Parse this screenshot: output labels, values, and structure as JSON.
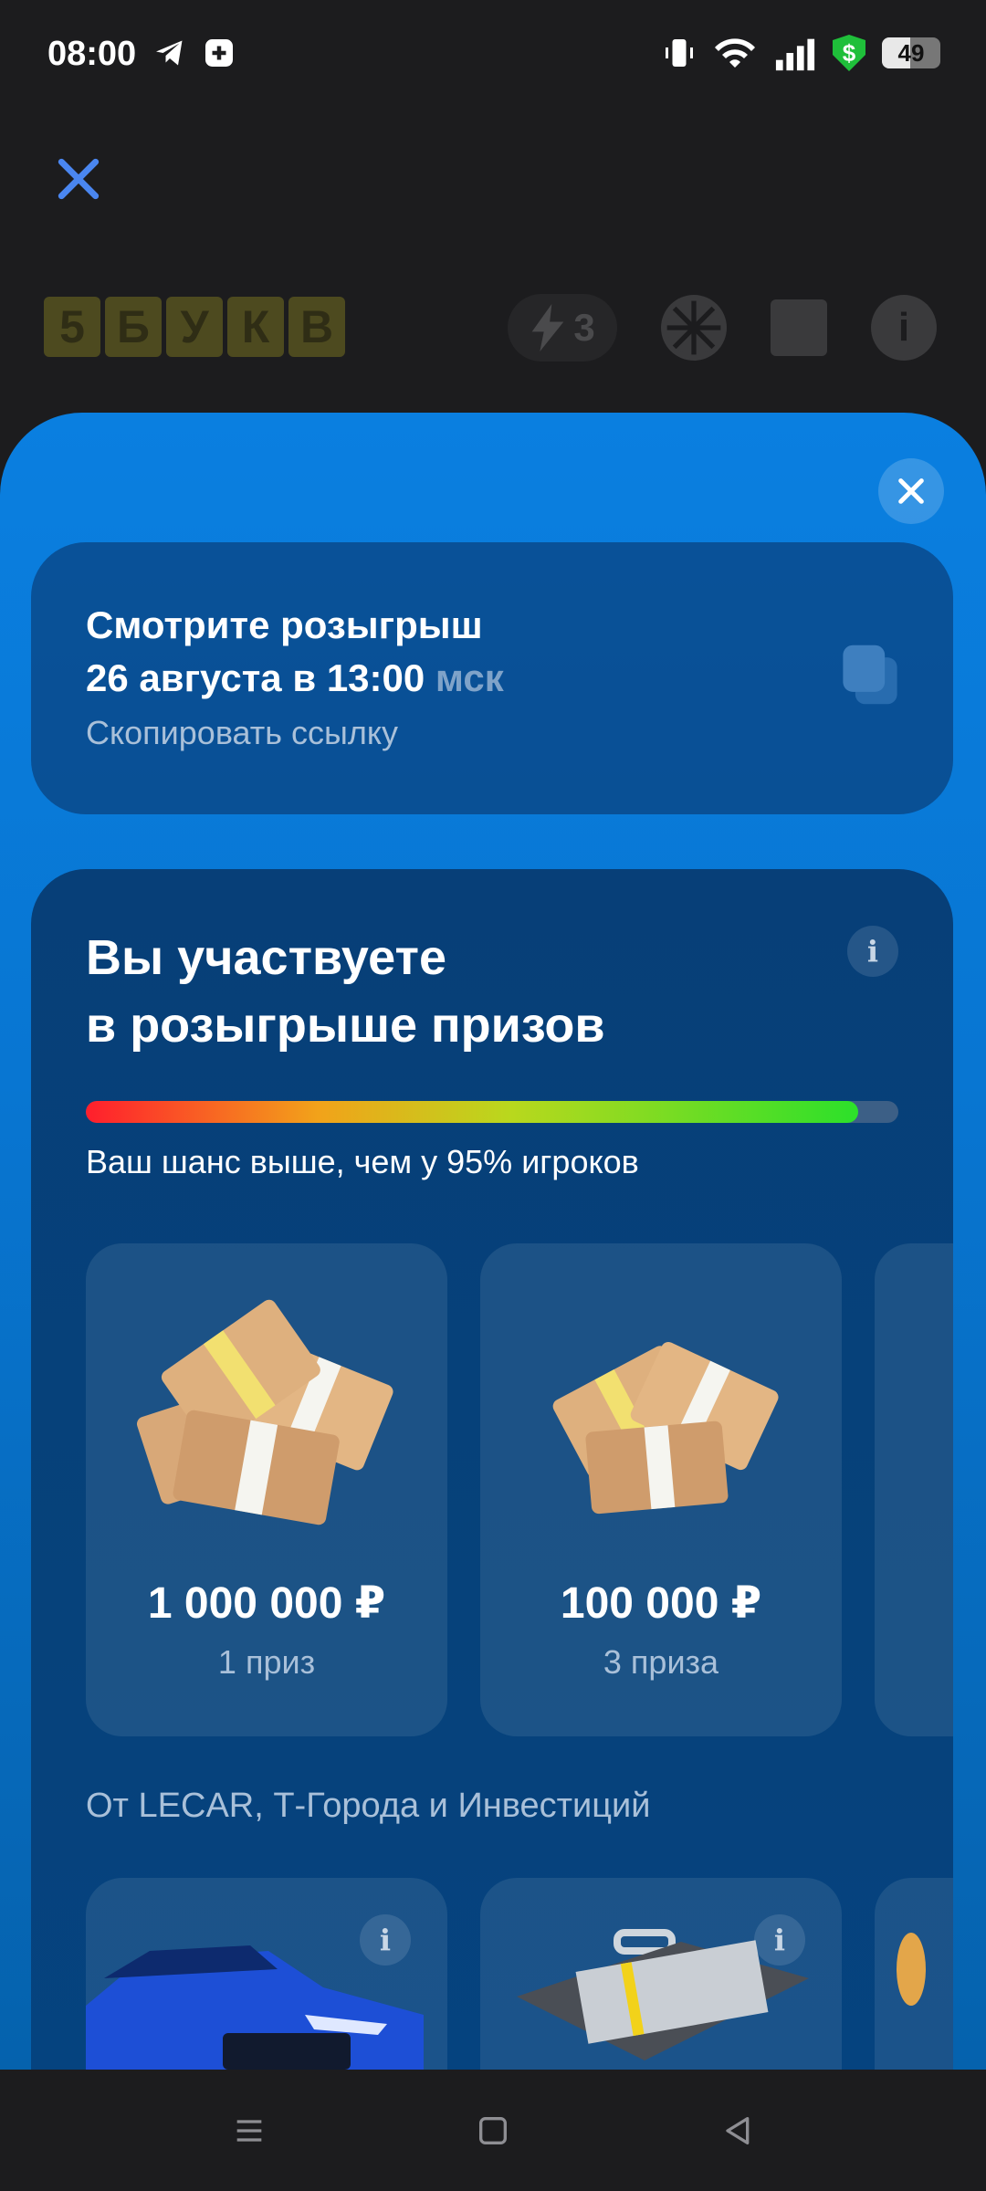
{
  "status_bar": {
    "time": "08:00",
    "battery": "49",
    "icons": [
      "telegram-icon",
      "app-icon",
      "vibrate-icon",
      "wifi-icon",
      "signal-icon",
      "shield-icon",
      "battery-icon"
    ]
  },
  "game_header": {
    "logo_letters": [
      "5",
      "Б",
      "У",
      "К",
      "В"
    ],
    "energy_count": "3"
  },
  "draw_card": {
    "title_line1": "Смотрите розыгрыш",
    "title_line2": "26 августа в 13:00",
    "timezone": "мск",
    "copy_link": "Скопировать ссылку"
  },
  "participation": {
    "title_line1": "Вы участвуете",
    "title_line2": "в розыгрыше призов",
    "chance_percent": 95,
    "chance_text": "Ваш шанс выше, чем у 95% игроков",
    "prizes": [
      {
        "amount": "1 000 000 ₽",
        "count": "1 приз"
      },
      {
        "amount": "100 000 ₽",
        "count": "3 приза"
      }
    ],
    "partners_title": "От LECAR, Т-Города и Инвестиций"
  },
  "colors": {
    "sheet_blue": "#0a7fe0",
    "card_dark": "#073f78",
    "progress_green": "#2ce02a",
    "progress_red": "#ff1e2d"
  }
}
